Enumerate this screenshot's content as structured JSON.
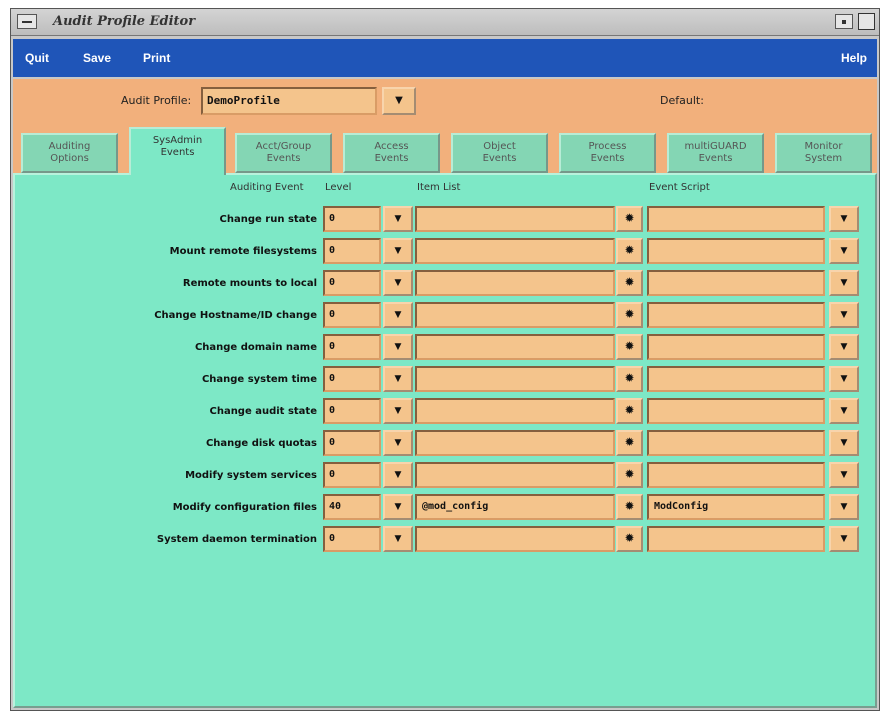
{
  "window": {
    "title": "Audit Profile Editor"
  },
  "menubar": {
    "quit": "Quit",
    "save": "Save",
    "print": "Print",
    "help": "Help"
  },
  "profile": {
    "label": "Audit Profile:",
    "value": "DemoProfile",
    "default_label": "Default:"
  },
  "tabs": [
    {
      "line1": "Auditing",
      "line2": "Options"
    },
    {
      "line1": "SysAdmin",
      "line2": "Events"
    },
    {
      "line1": "Acct/Group",
      "line2": "Events"
    },
    {
      "line1": "Access",
      "line2": "Events"
    },
    {
      "line1": "Object",
      "line2": "Events"
    },
    {
      "line1": "Process",
      "line2": "Events"
    },
    {
      "line1": "multiGUARD",
      "line2": "Events"
    },
    {
      "line1": "Monitor",
      "line2": "System"
    }
  ],
  "active_tab": 1,
  "columns": {
    "event": "Auditing Event",
    "level": "Level",
    "item_list": "Item List",
    "script": "Event Script"
  },
  "rows": [
    {
      "event": "Change run state",
      "level": "0",
      "item_list": "",
      "script": ""
    },
    {
      "event": "Mount remote filesystems",
      "level": "0",
      "item_list": "",
      "script": ""
    },
    {
      "event": "Remote mounts to local",
      "level": "0",
      "item_list": "",
      "script": ""
    },
    {
      "event": "Change Hostname/ID change",
      "level": "0",
      "item_list": "",
      "script": ""
    },
    {
      "event": "Change domain name",
      "level": "0",
      "item_list": "",
      "script": ""
    },
    {
      "event": "Change system time",
      "level": "0",
      "item_list": "",
      "script": ""
    },
    {
      "event": "Change audit state",
      "level": "0",
      "item_list": "",
      "script": ""
    },
    {
      "event": "Change disk quotas",
      "level": "0",
      "item_list": "",
      "script": ""
    },
    {
      "event": "Modify system services",
      "level": "0",
      "item_list": "",
      "script": ""
    },
    {
      "event": "Modify configuration files",
      "level": "40",
      "item_list": "@mod_config",
      "script": "ModConfig"
    },
    {
      "event": "System daemon termination",
      "level": "0",
      "item_list": "",
      "script": ""
    }
  ],
  "icons": {
    "dropdown": "arrow-down-icon",
    "item_picker": "starburst-icon"
  }
}
